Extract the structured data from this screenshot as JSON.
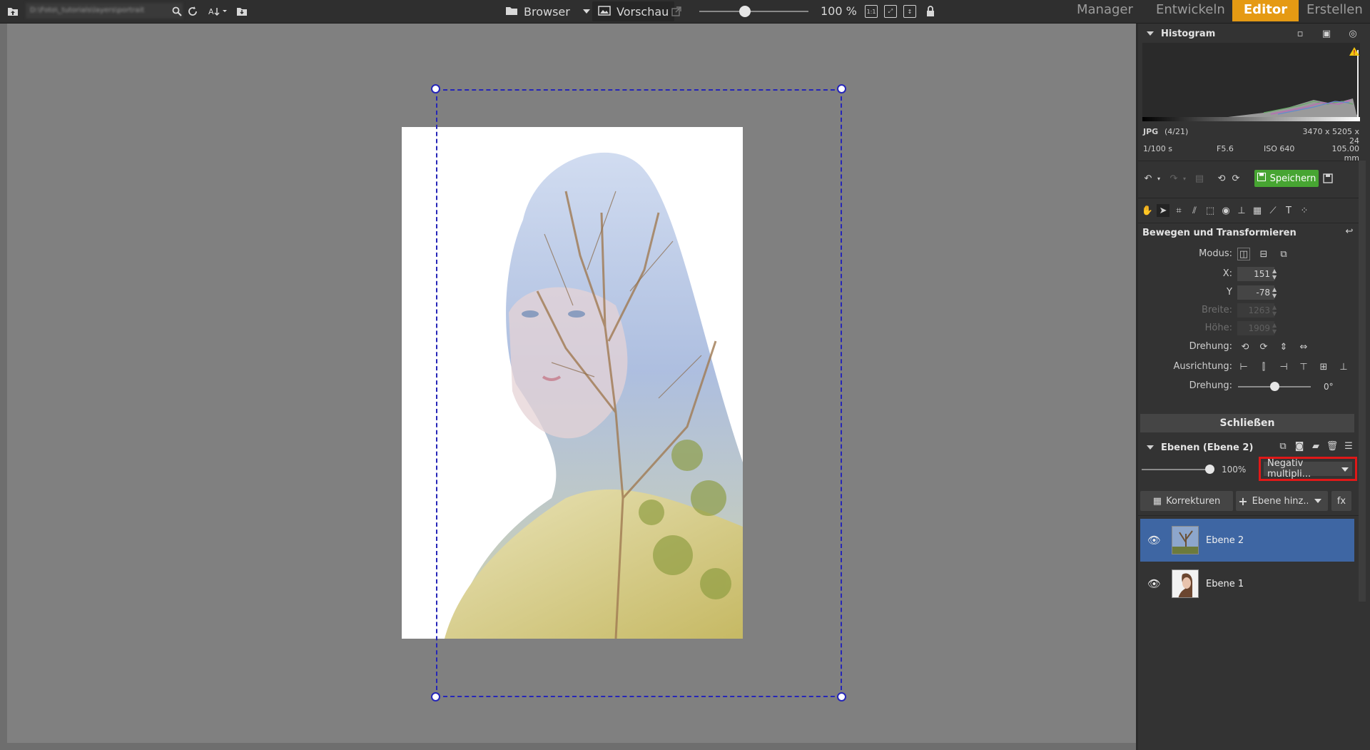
{
  "topbar": {
    "path_text": "D:\\Foto\\_tutorials\\layers\\portrait",
    "browser_label": "Browser",
    "preview_label": "Vorschau",
    "zoom_label": "100 %",
    "zoom_fraction": 0.4,
    "tabs": [
      "Manager",
      "Entwickeln",
      "Editor",
      "Erstellen"
    ],
    "active_tab": "Editor",
    "accent": "#e59a13"
  },
  "histogram": {
    "title": "Histogram",
    "format": "JPG",
    "index": "(4/21)",
    "dimensions": "3470 x 5205 x 24",
    "shutter": "1/100 s",
    "aperture": "F5.6",
    "iso": "ISO 640",
    "focal": "105.00 mm",
    "warning_icon": "warning-icon"
  },
  "toolbar": {
    "save_label": "Speichern",
    "save_color": "#47a532"
  },
  "transform": {
    "title": "Bewegen und Transformieren",
    "mode_label": "Modus:",
    "x_label": "X:",
    "x_value": "151",
    "y_label": "Y",
    "y_value": "-78",
    "width_label": "Breite:",
    "width_value": "1263",
    "height_label": "Höhe:",
    "height_value": "1909",
    "rotation_label": "Drehung:",
    "align_label": "Ausrichtung:",
    "angle_label": "Drehung:",
    "angle_value": "0°",
    "angle_fraction": 0.5
  },
  "close_label": "Schließen",
  "layers": {
    "title": "Ebenen (Ebene 2)",
    "opacity": "100%",
    "opacity_fraction": 1.0,
    "blend_mode": "Negativ multipli...",
    "corrections_label": "Korrekturen",
    "add_layer_label": "Ebene hinz...",
    "fx_label": "fx",
    "items": [
      {
        "name": "Ebene 2",
        "selected": true
      },
      {
        "name": "Ebene 1",
        "selected": false
      }
    ],
    "selected_color": "#3e66a3"
  }
}
